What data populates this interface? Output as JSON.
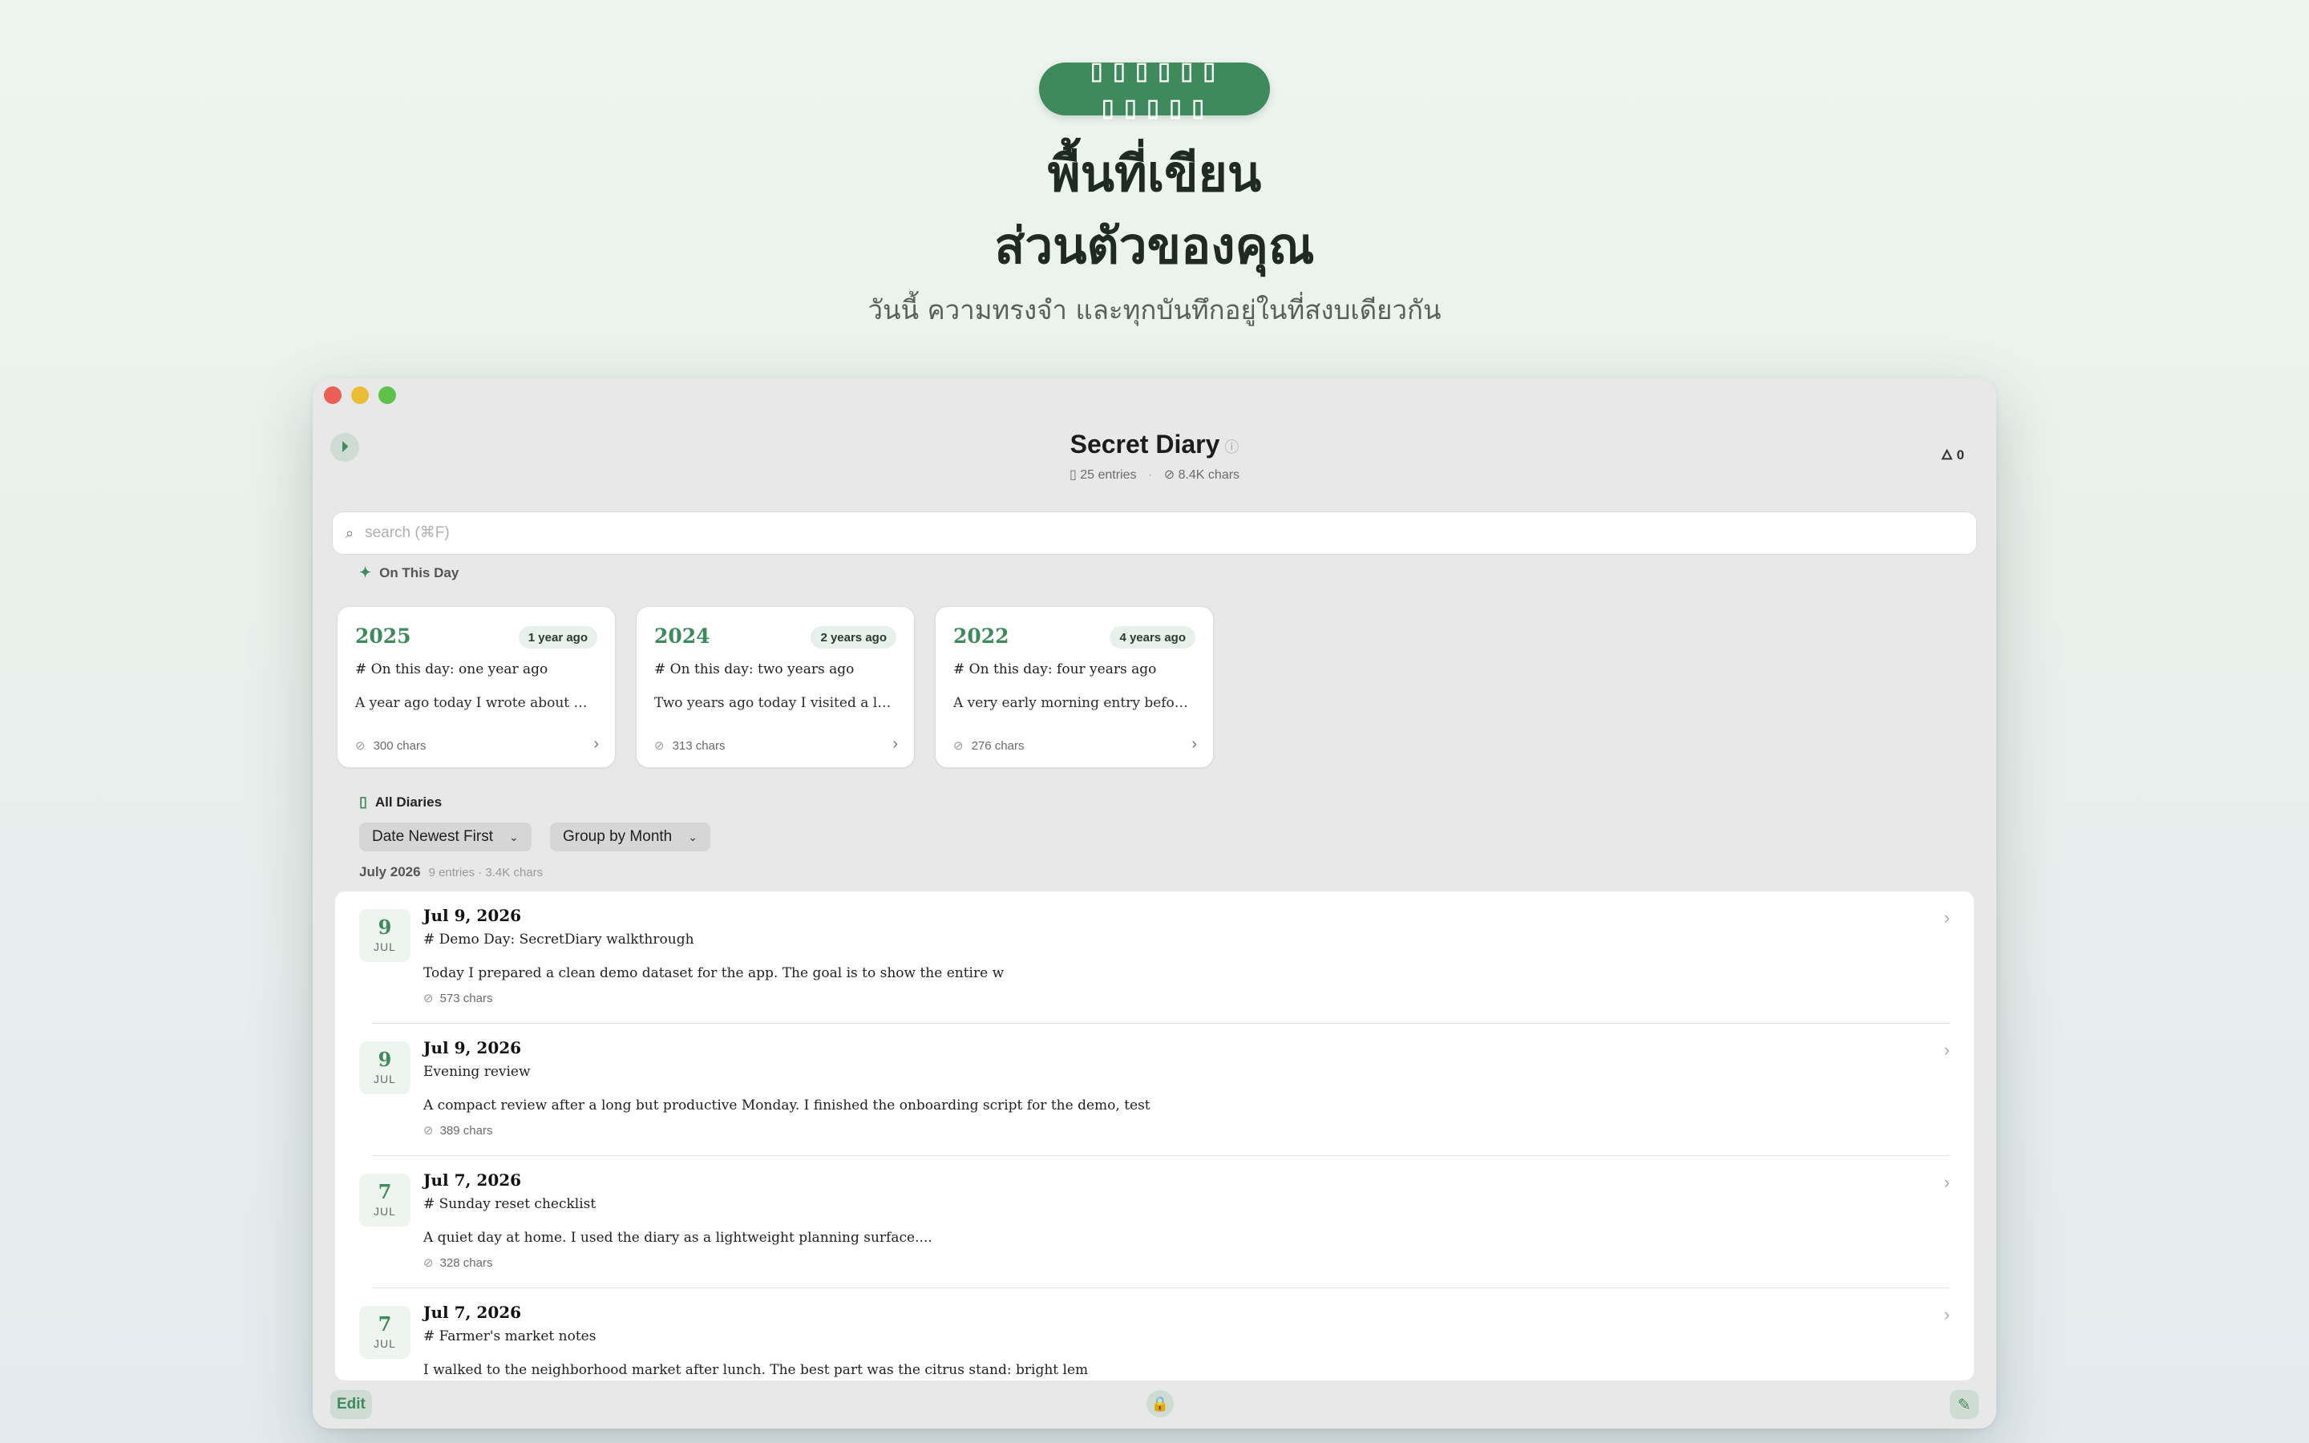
{
  "hero": {
    "pill": "▯▯▯▯▯▯ ▯▯▯▯▯",
    "title_line1": "พื้นที่เขียน",
    "title_line2": "ส่วนตัวของคุณ",
    "subtitle": "วันนี้ ความทรงจำ และทุกบันทึกอยู่ในที่สงบเดียวกัน"
  },
  "window": {
    "title": "Secret Diary",
    "info_icon": "ⓘ",
    "entries_count": "25 entries",
    "chars_count": "8.4K chars",
    "streak_value": "0",
    "search_placeholder": "search (⌘F)"
  },
  "on_this_day": {
    "label": "On This Day",
    "cards": [
      {
        "year": "2025",
        "ago": "1 year ago",
        "heading": "# On this day: one year ago",
        "excerpt": "A year ago today I wrote about making notes before",
        "chars": "300 chars"
      },
      {
        "year": "2024",
        "ago": "2 years ago",
        "heading": "# On this day: two years ago",
        "excerpt": "Two years ago today I visited a library and sat",
        "chars": "313 chars"
      },
      {
        "year": "2022",
        "ago": "4 years ago",
        "heading": "# On this day: four years ago",
        "excerpt": "A very early morning entry before a trip to the",
        "chars": "276 chars"
      }
    ]
  },
  "all_diaries": {
    "label": "All Diaries",
    "sort_label": "Date Newest First",
    "group_label": "Group by Month",
    "month_label": "July 2026",
    "month_meta": "9 entries · 3.4K chars",
    "entries": [
      {
        "day": "9",
        "month": "JUL",
        "date": "Jul 9, 2026",
        "title": "# Demo Day: SecretDiary walkthrough",
        "body": "Today I prepared a clean demo dataset for the app. The goal is to show the entire w",
        "chars": "573 chars"
      },
      {
        "day": "9",
        "month": "JUL",
        "date": "Jul 9, 2026",
        "title": "Evening review",
        "body": "A compact review after a long but productive Monday. I finished the onboarding script for the demo, test",
        "chars": "389 chars"
      },
      {
        "day": "7",
        "month": "JUL",
        "date": "Jul 7, 2026",
        "title": "# Sunday reset checklist",
        "body": "A quiet day at home. I used the diary as a lightweight planning surface....",
        "chars": "328 chars"
      },
      {
        "day": "7",
        "month": "JUL",
        "date": "Jul 7, 2026",
        "title": "# Farmer's market notes",
        "body": "I walked to the neighborhood market after lunch. The best part was the citrus stand: bright lem",
        "chars": ""
      }
    ]
  },
  "bottom": {
    "edit_label": "Edit"
  },
  "colors": {
    "accent": "#3e8a5c",
    "accent_soft": "#e7f0ea"
  }
}
